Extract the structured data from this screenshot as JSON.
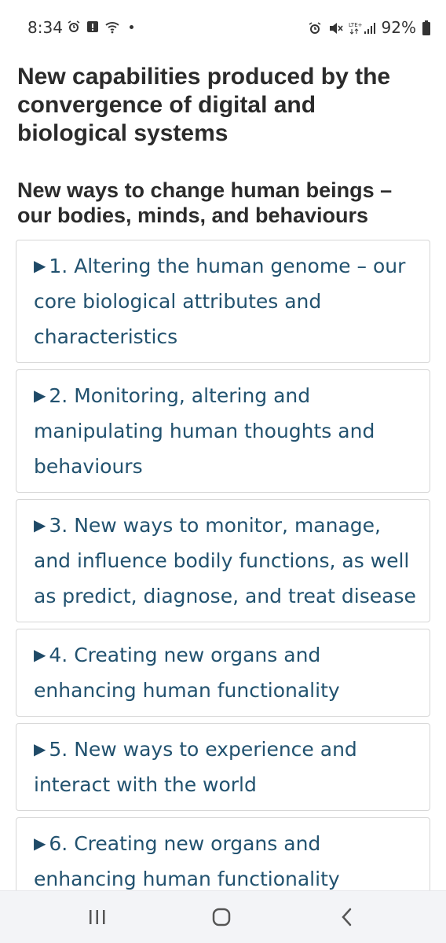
{
  "status_bar": {
    "time": "8:34",
    "battery": "92%",
    "left_icons": [
      "alarm-icon",
      "alert-icon",
      "wifi-icon",
      "dot-icon"
    ],
    "right_icons": [
      "alarm-icon",
      "mute-icon",
      "lte-signal-icon",
      "battery-icon"
    ]
  },
  "page": {
    "heading1": "New capabilities produced by the convergence of digital and biological systems",
    "heading2": "New ways to change human beings – our bodies, minds, and behaviours",
    "items": [
      {
        "label": "1. Altering the human genome – our core biological attributes and characteristics"
      },
      {
        "label": "2. Monitoring, altering and manipulating human thoughts and behaviours"
      },
      {
        "label": "3. New ways to monitor, manage, and influence bodily functions, as well as predict, diagnose, and treat disease"
      },
      {
        "label": "4. Creating new organs and enhancing human functionality"
      },
      {
        "label": "5. New ways to experience and interact with the world"
      },
      {
        "label": "6. Creating new organs and enhancing human functionality"
      }
    ]
  },
  "nav_bar": {
    "icons": [
      "recents-icon",
      "home-icon",
      "back-icon"
    ]
  },
  "colors": {
    "link": "#22526f",
    "heading": "#2b2b2b",
    "border": "#d6d6d6",
    "nav_bg": "#f3f4f7"
  }
}
